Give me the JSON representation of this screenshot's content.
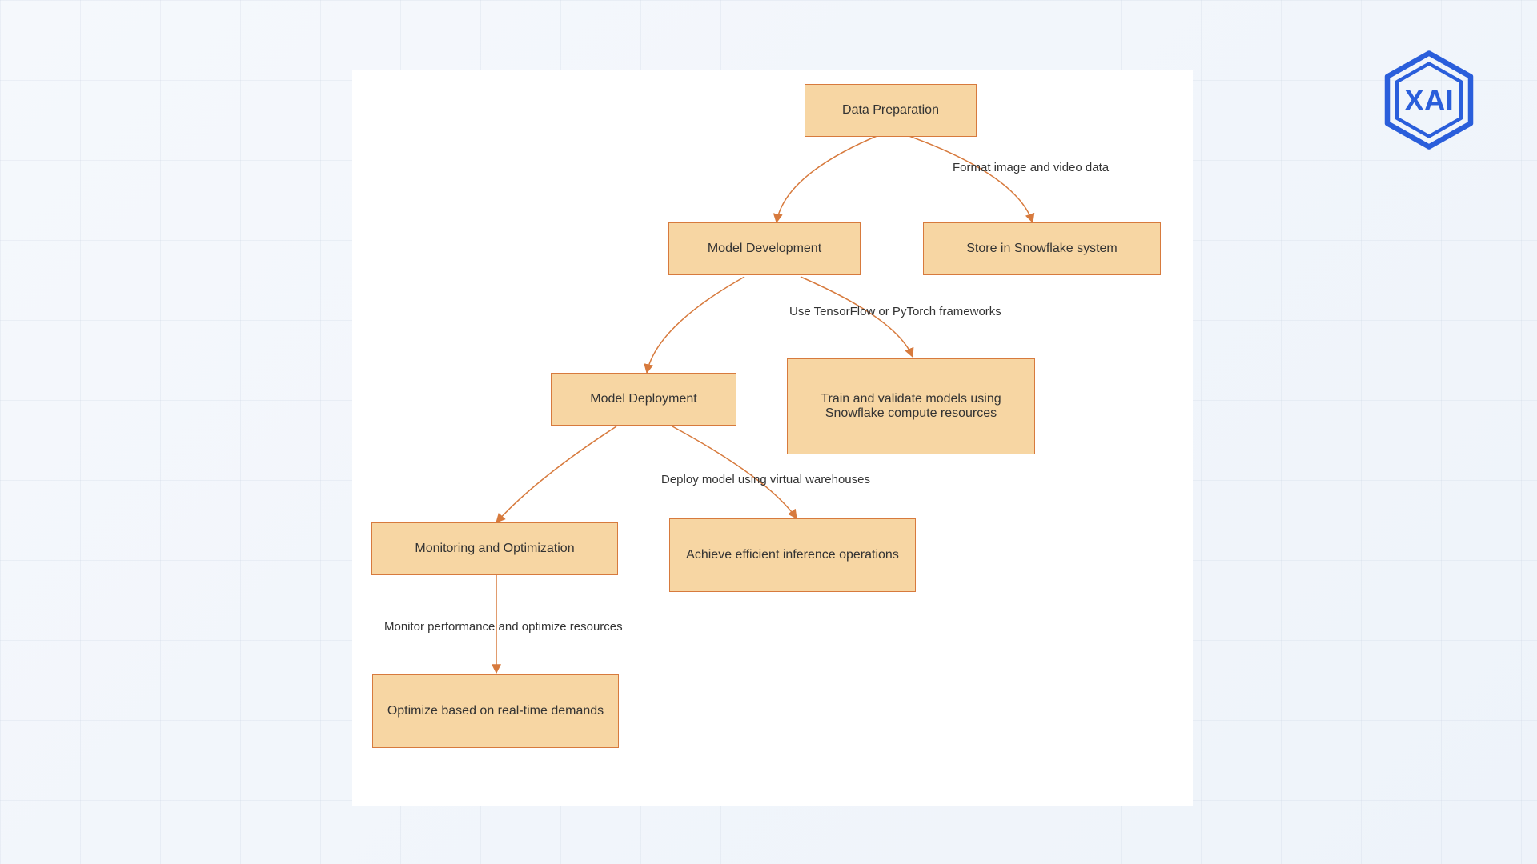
{
  "logo": {
    "text": "XAI",
    "color": "#2a5edb"
  },
  "nodes": {
    "n1": {
      "label": "Data Preparation"
    },
    "n2": {
      "label": "Model Development"
    },
    "n3": {
      "label": "Store in Snowflake system"
    },
    "n4": {
      "label": "Model Deployment"
    },
    "n5": {
      "label": "Train and validate models using Snowflake compute resources"
    },
    "n6": {
      "label": "Monitoring and Optimization"
    },
    "n7": {
      "label": "Achieve efficient inference operations"
    },
    "n8": {
      "label": "Optimize based on real-time demands"
    }
  },
  "edges": {
    "e1": {
      "label": "Format image and video data"
    },
    "e2": {
      "label": "Use TensorFlow or PyTorch frameworks"
    },
    "e3": {
      "label": "Deploy model using virtual warehouses"
    },
    "e4": {
      "label": "Monitor performance and optimize resources"
    }
  },
  "colors": {
    "node_fill": "#f7d6a3",
    "node_border": "#d77a3d",
    "arrow": "#d77a3d",
    "logo": "#2a5edb"
  }
}
